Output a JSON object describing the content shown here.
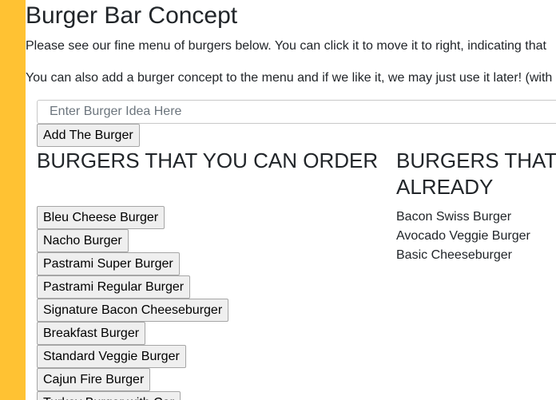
{
  "colors": {
    "sidebar_accent": "#FFC233"
  },
  "page": {
    "title": "Burger Bar Concept",
    "intro_1": "Please see our fine menu of burgers below. You can click it to move it to right, indicating that",
    "intro_2": "You can also add a burger concept to the menu and if we like it, we may just use it later! (with"
  },
  "form": {
    "placeholder": "Enter Burger Idea Here",
    "add_button_label": "Add The Burger"
  },
  "order_section": {
    "title": "BURGERS THAT YOU CAN ORDER",
    "items": [
      "Bleu Cheese Burger",
      "Nacho Burger",
      "Pastrami Super Burger",
      "Pastrami Regular Burger",
      "Signature Bacon Cheeseburger",
      "Breakfast Burger",
      "Standard Veggie Burger",
      "Cajun Fire Burger",
      "Turkey Burger with Cor"
    ]
  },
  "have_section": {
    "title": "BURGERS THAT ALREADY",
    "items": [
      "Bacon Swiss Burger",
      "Avocado Veggie Burger",
      "Basic Cheeseburger"
    ]
  }
}
